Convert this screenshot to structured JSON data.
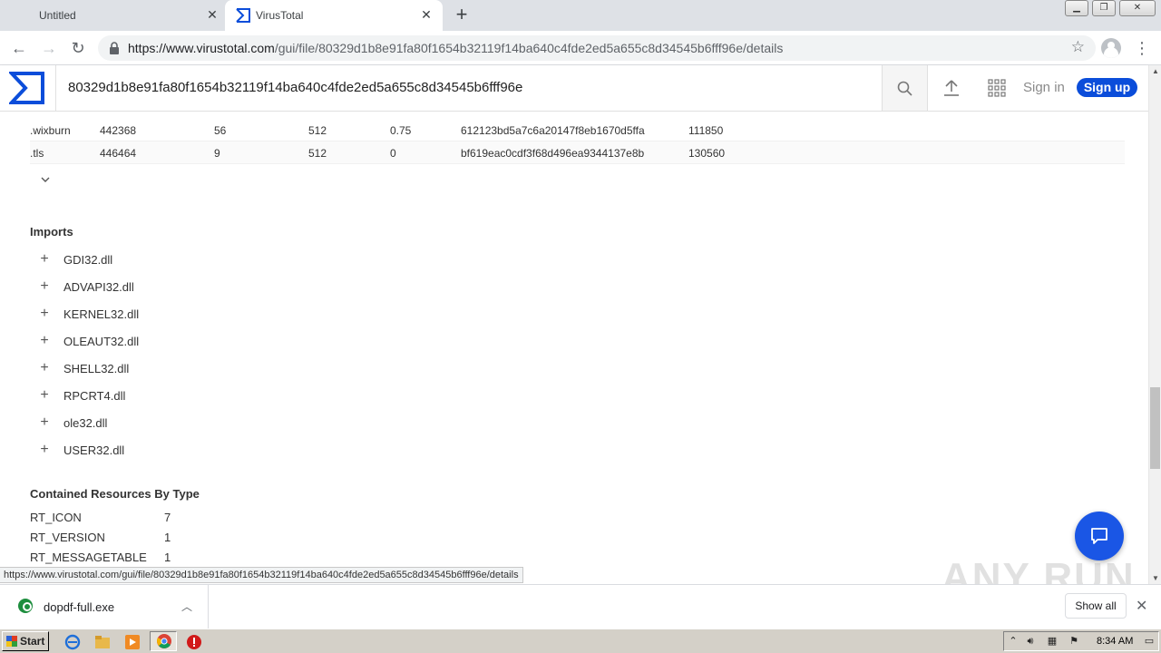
{
  "browser": {
    "tabs": [
      {
        "title": "Untitled",
        "active": false
      },
      {
        "title": "VirusTotal",
        "active": true
      }
    ],
    "url_host": "https://www.virustotal.com",
    "url_path": "/gui/file/80329d1b8e91fa80f1654b32119f14ba640c4fde2ed5a655c8d34545b6fff96e/details",
    "status_url": "https://www.virustotal.com/gui/file/80329d1b8e91fa80f1654b32119f14ba640c4fde2ed5a655c8d34545b6fff96e/details"
  },
  "vt": {
    "search_value": "80329d1b8e91fa80f1654b32119f14ba640c4fde2ed5a655c8d34545b6fff96e",
    "signin_label": "Sign in",
    "signup_label": "Sign up",
    "brand_color": "#0b4dda"
  },
  "sections": [
    {
      "name": ".wixburn",
      "virtual_address": "442368",
      "virtual_size": "56",
      "raw_size": "512",
      "entropy": "0.75",
      "md5": "612123bd5a7c6a20147f8eb1670d5ffa",
      "chi2": "111850"
    },
    {
      "name": ".tls",
      "virtual_address": "446464",
      "virtual_size": "9",
      "raw_size": "512",
      "entropy": "0",
      "md5": "bf619eac0cdf3f68d496ea9344137e8b",
      "chi2": "130560"
    }
  ],
  "imports": {
    "title": "Imports",
    "items": [
      "GDI32.dll",
      "ADVAPI32.dll",
      "KERNEL32.dll",
      "OLEAUT32.dll",
      "SHELL32.dll",
      "RPCRT4.dll",
      "ole32.dll",
      "USER32.dll"
    ]
  },
  "resources": {
    "title": "Contained Resources By Type",
    "items": [
      {
        "type": "RT_ICON",
        "count": "7"
      },
      {
        "type": "RT_VERSION",
        "count": "1"
      },
      {
        "type": "RT_MESSAGETABLE",
        "count": "1"
      }
    ]
  },
  "download": {
    "filename": "dopdf-full.exe",
    "show_all_label": "Show all"
  },
  "watermark": "ANY RUN",
  "taskbar": {
    "start_label": "Start",
    "clock": "8:34 AM"
  }
}
